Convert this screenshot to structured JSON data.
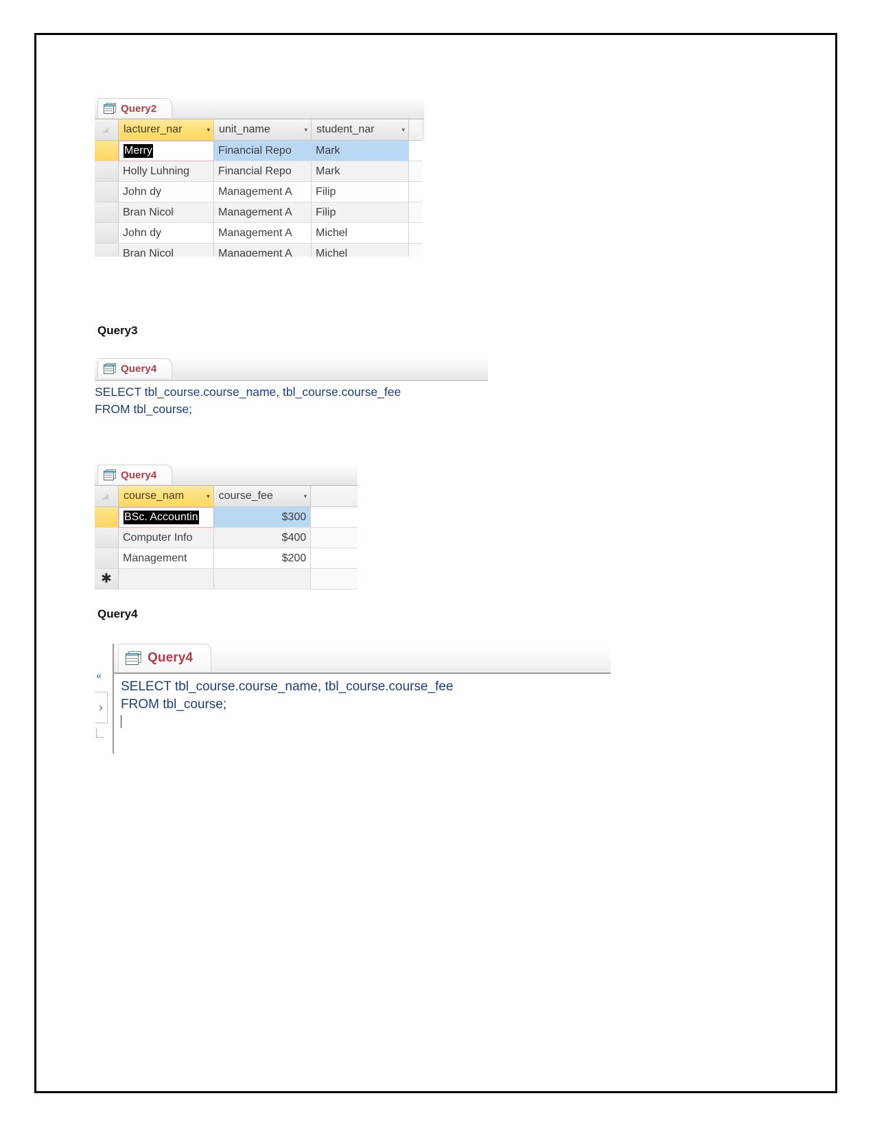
{
  "document": {
    "sections": [
      {
        "caption": "Query3"
      },
      {
        "caption": "Query4"
      }
    ]
  },
  "figures": {
    "query2_datasheet": {
      "tab_label": "Query2",
      "tab_icon": "query-datasheet-icon",
      "columns": [
        {
          "label": "lacturer_nar",
          "selected": true,
          "caret": "▾"
        },
        {
          "label": "unit_name",
          "selected": false,
          "caret": "▾"
        },
        {
          "label": "student_nar",
          "selected": false,
          "caret": "▾"
        }
      ],
      "rows": [
        {
          "lecturer": "Merry",
          "unit": "Financial Repo",
          "student": "Mark",
          "current": true
        },
        {
          "lecturer": "Holly Luhning",
          "unit": "Financial Repo",
          "student": "Mark",
          "current": false
        },
        {
          "lecturer": "John dy",
          "unit": "Management A",
          "student": "Filip",
          "current": false
        },
        {
          "lecturer": "Bran Nicol",
          "unit": "Management A",
          "student": "Filip",
          "current": false
        },
        {
          "lecturer": "John dy",
          "unit": "Management A",
          "student": "Michel",
          "current": false
        },
        {
          "lecturer": "Bran Nicol",
          "unit": "Management A",
          "student": "Michel",
          "current": false
        }
      ]
    },
    "sql_view_top": {
      "tab_label": "Query4",
      "tab_icon": "query-datasheet-icon",
      "sql_line1": "SELECT tbl_course.course_name, tbl_course.course_fee",
      "sql_line2": "FROM tbl_course;"
    },
    "query4_datasheet": {
      "tab_label": "Query4",
      "tab_icon": "query-datasheet-icon",
      "columns": [
        {
          "label": "course_nam",
          "selected": true,
          "caret": "▾"
        },
        {
          "label": "course_fee",
          "selected": false,
          "caret": "▾"
        }
      ],
      "rows": [
        {
          "course_name": "BSc. Accountin",
          "course_fee": "$300",
          "current": true
        },
        {
          "course_name": "Computer Info",
          "course_fee": "$400",
          "current": false
        },
        {
          "course_name": "Management",
          "course_fee": "$200",
          "current": false
        }
      ],
      "new_record_marker": "✱"
    },
    "sql_view_bottom": {
      "tab_label": "Query4",
      "tab_icon": "query-datasheet-icon",
      "sql_line1": "SELECT tbl_course.course_name, tbl_course.course_fee",
      "sql_line2": "FROM tbl_course;",
      "nav_chevron": "«",
      "nav_shutter": "›"
    }
  },
  "colors": {
    "tab_label": "#b23c47",
    "selected_column_header": "#ffd95f",
    "column_header": "#e9e9e9",
    "row_highlight": "#b8d8f4",
    "active_cell_border": "#f2a8b4",
    "sql_text": "#1f3d7a",
    "page_border": "#000000"
  }
}
